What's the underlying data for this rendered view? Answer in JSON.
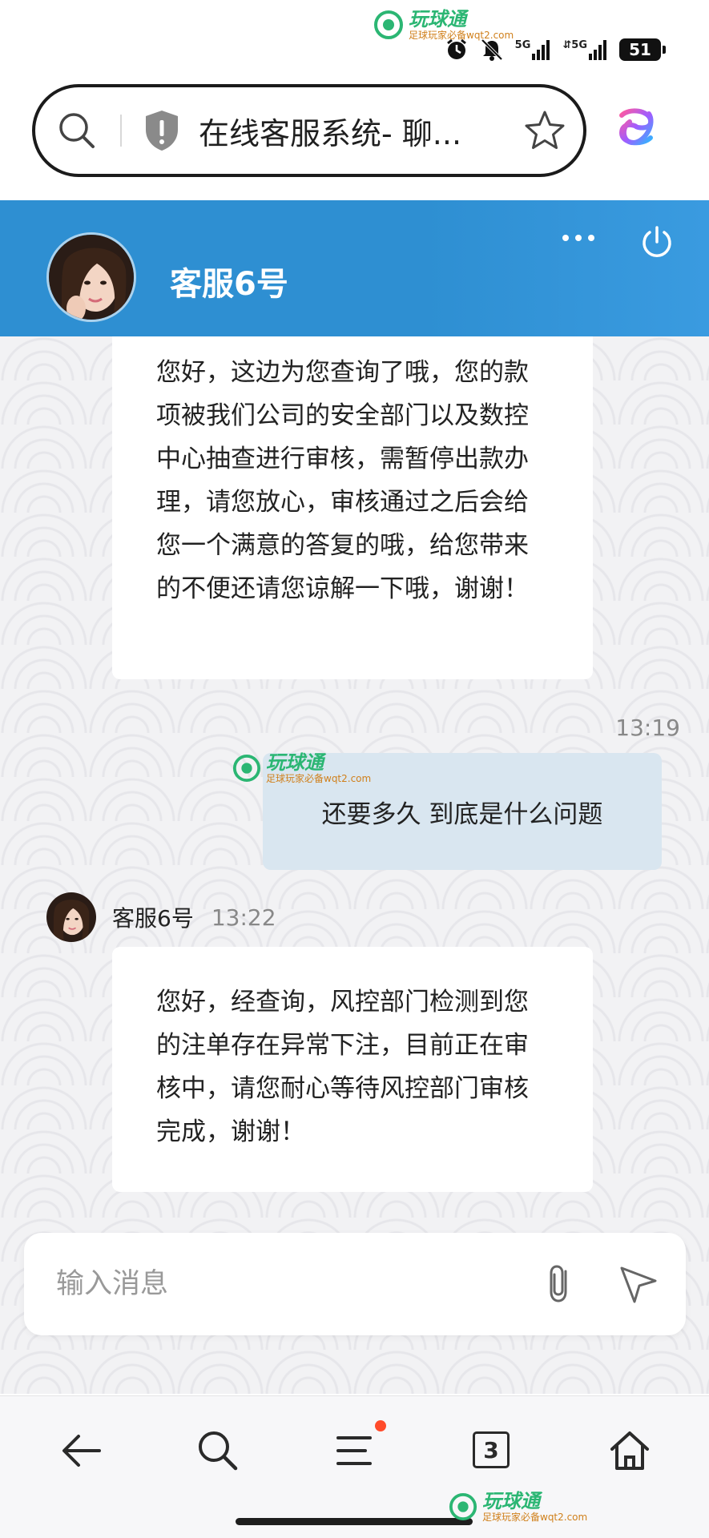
{
  "status_bar": {
    "network_1": "5G",
    "network_2": "5G",
    "battery": "51"
  },
  "watermark": {
    "brand": "玩球通",
    "sub": "足球玩家必备wqt2.com"
  },
  "browser": {
    "address_text": "在线客服系统- 聊..."
  },
  "header": {
    "agent_name": "客服6号"
  },
  "messages": [
    {
      "side": "left",
      "text": "您好，这边为您查询了哦，您的款项被我们公司的安全部门以及数控中心抽查进行审核，需暂停出款办理，请您放心，审核通过之后会给您一个满意的答复的哦，给您带来的不便还请您谅解一下哦，谢谢！"
    },
    {
      "side": "right",
      "time": "13:19",
      "text": "还要多久 到底是什么问题"
    },
    {
      "side": "left",
      "sender": "客服6号",
      "time": "13:22",
      "text": "您好，经查询，风控部门检测到您的注单存在异常下注，目前正在审核中，请您耐心等待风控部门审核完成，谢谢！"
    }
  ],
  "input": {
    "placeholder": "输入消息"
  },
  "bottom_nav": {
    "tab_count": "3",
    "icons": [
      "back-arrow-icon",
      "search-icon",
      "menu-icon",
      "tabs-icon",
      "home-icon"
    ]
  },
  "colors": {
    "header_blue": "#2e8fd2",
    "outgoing_bubble": "#d9e6f0",
    "chat_background": "#f2f2f4",
    "notification_dot": "#ff4b2b"
  }
}
